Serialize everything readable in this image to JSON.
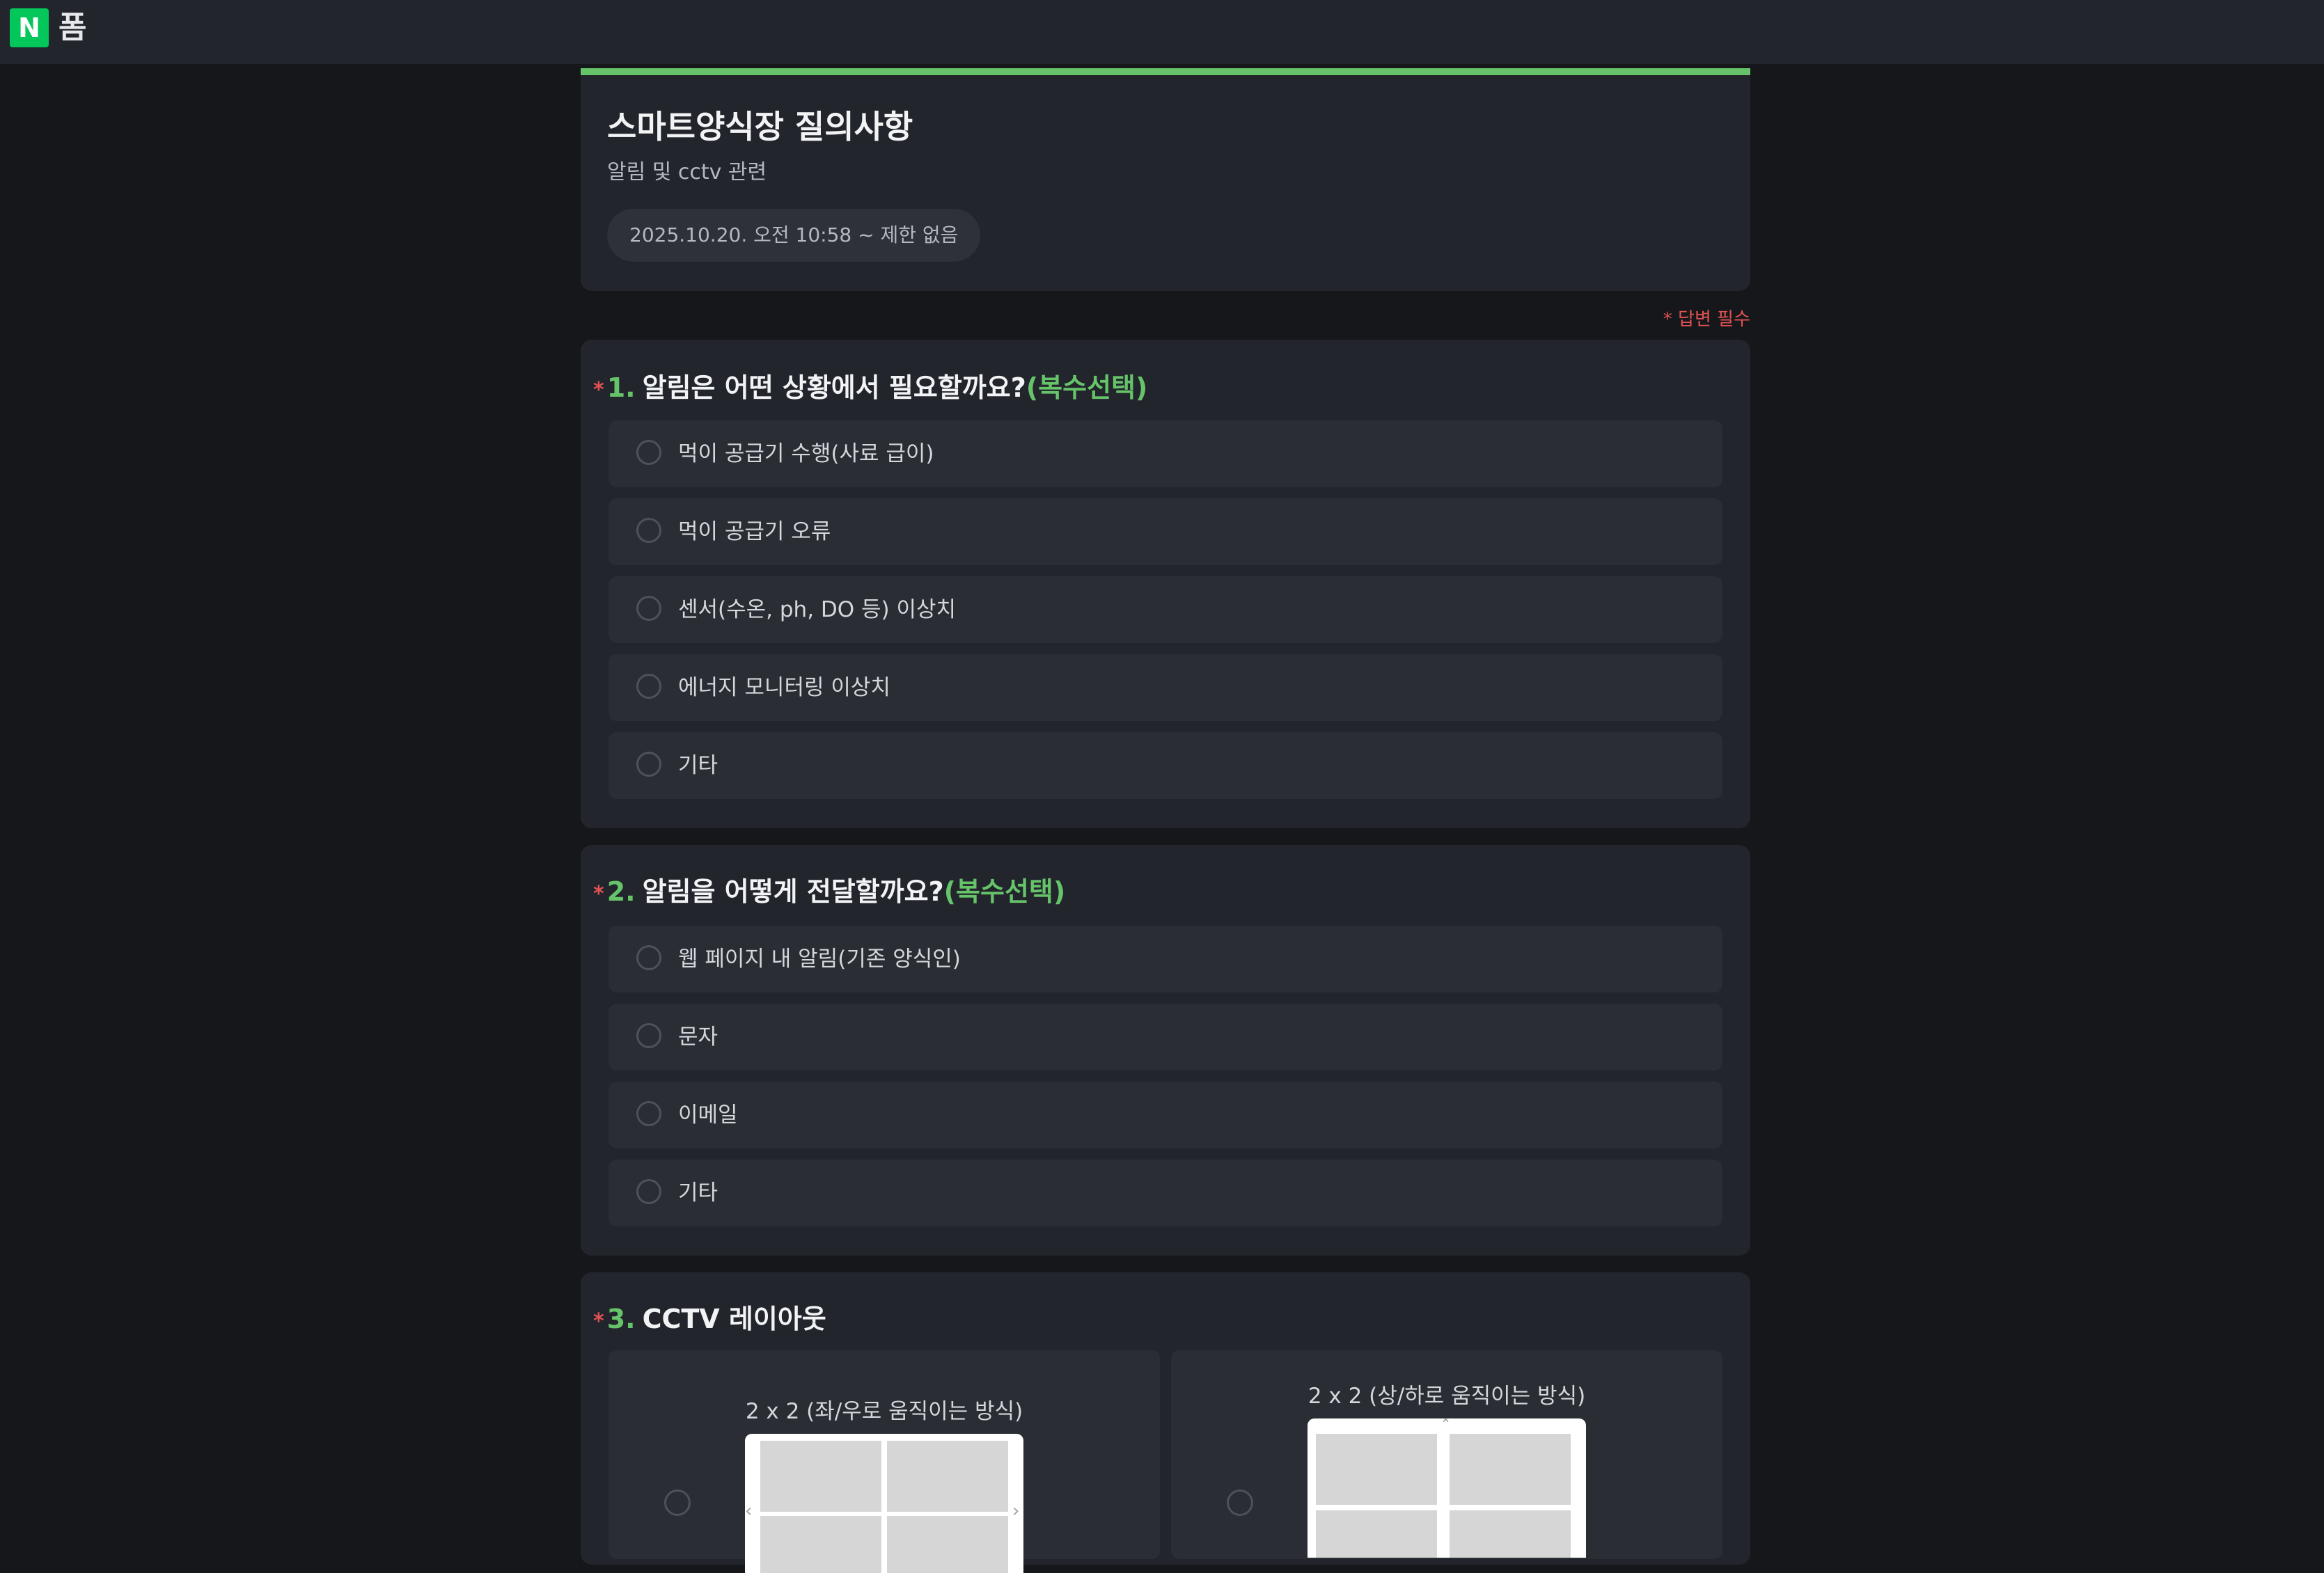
{
  "app": {
    "logo_letter": "N",
    "logo_text": "폼"
  },
  "header": {
    "title": "스마트양식장 질의사항",
    "description": "알림 및 cctv 관련",
    "period": "2025.10.20. 오전 10:58 ~ 제한 없음"
  },
  "required_note": "* 답변 필수",
  "questions": [
    {
      "star": "*",
      "number": "1.",
      "text": "알림은 어떤 상황에서 필요할까요?",
      "hint": "(복수선택)",
      "options": [
        "먹이 공급기 수행(사료 급이)",
        "먹이 공급기 오류",
        "센서(수온,  ph, DO 등) 이상치",
        "에너지 모니터링 이상치",
        "기타"
      ]
    },
    {
      "star": "*",
      "number": "2.",
      "text": "알림을 어떻게 전달할까요?",
      "hint": "(복수선택)",
      "options": [
        "웹 페이지 내 알림(기존 양식인)",
        "문자",
        "이메일",
        "기타"
      ]
    },
    {
      "star": "*",
      "number": "3.",
      "text": "CCTV 레이아웃",
      "hint": "",
      "layout_options": [
        "2 x 2 (좌/우로 움직이는 방식)",
        "2 x 2 (상/하로 움직이는 방식)"
      ]
    }
  ],
  "colors": {
    "accent": "#66c36a",
    "required": "#e05252",
    "brand": "#03c75a",
    "background": "#16171b",
    "card": "#22252c"
  }
}
